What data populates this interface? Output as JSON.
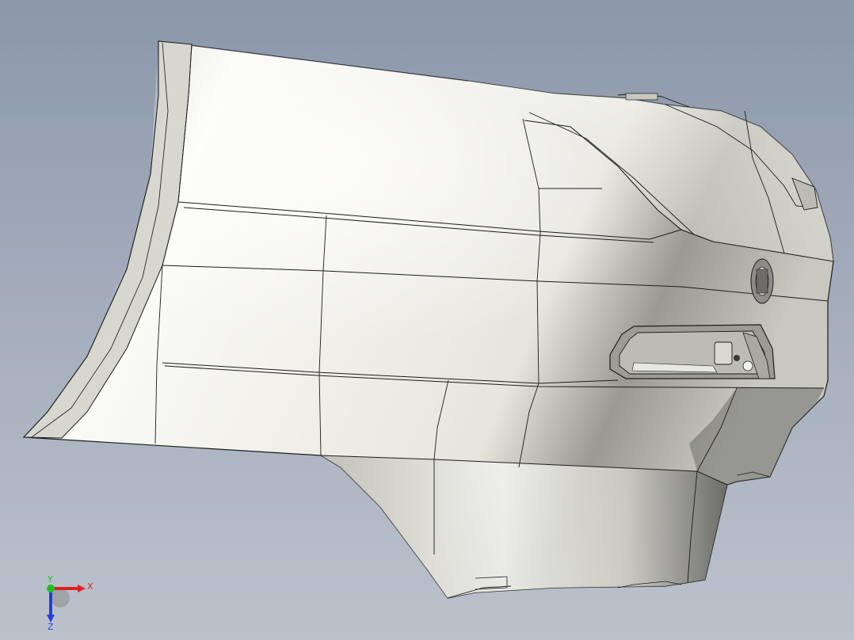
{
  "viewport": {
    "background_top": "#8b97aa",
    "background_bottom": "#bcc2cc"
  },
  "model": {
    "part": "rear-quarter-panel",
    "surface_color": "#d9d9d3",
    "edge_color": "#1c1c1c"
  },
  "triad": {
    "x_label": "X",
    "y_label": "Y",
    "z_label": "Z",
    "x_color": "#e02020",
    "y_color": "#20c020",
    "z_color": "#2040e0"
  }
}
